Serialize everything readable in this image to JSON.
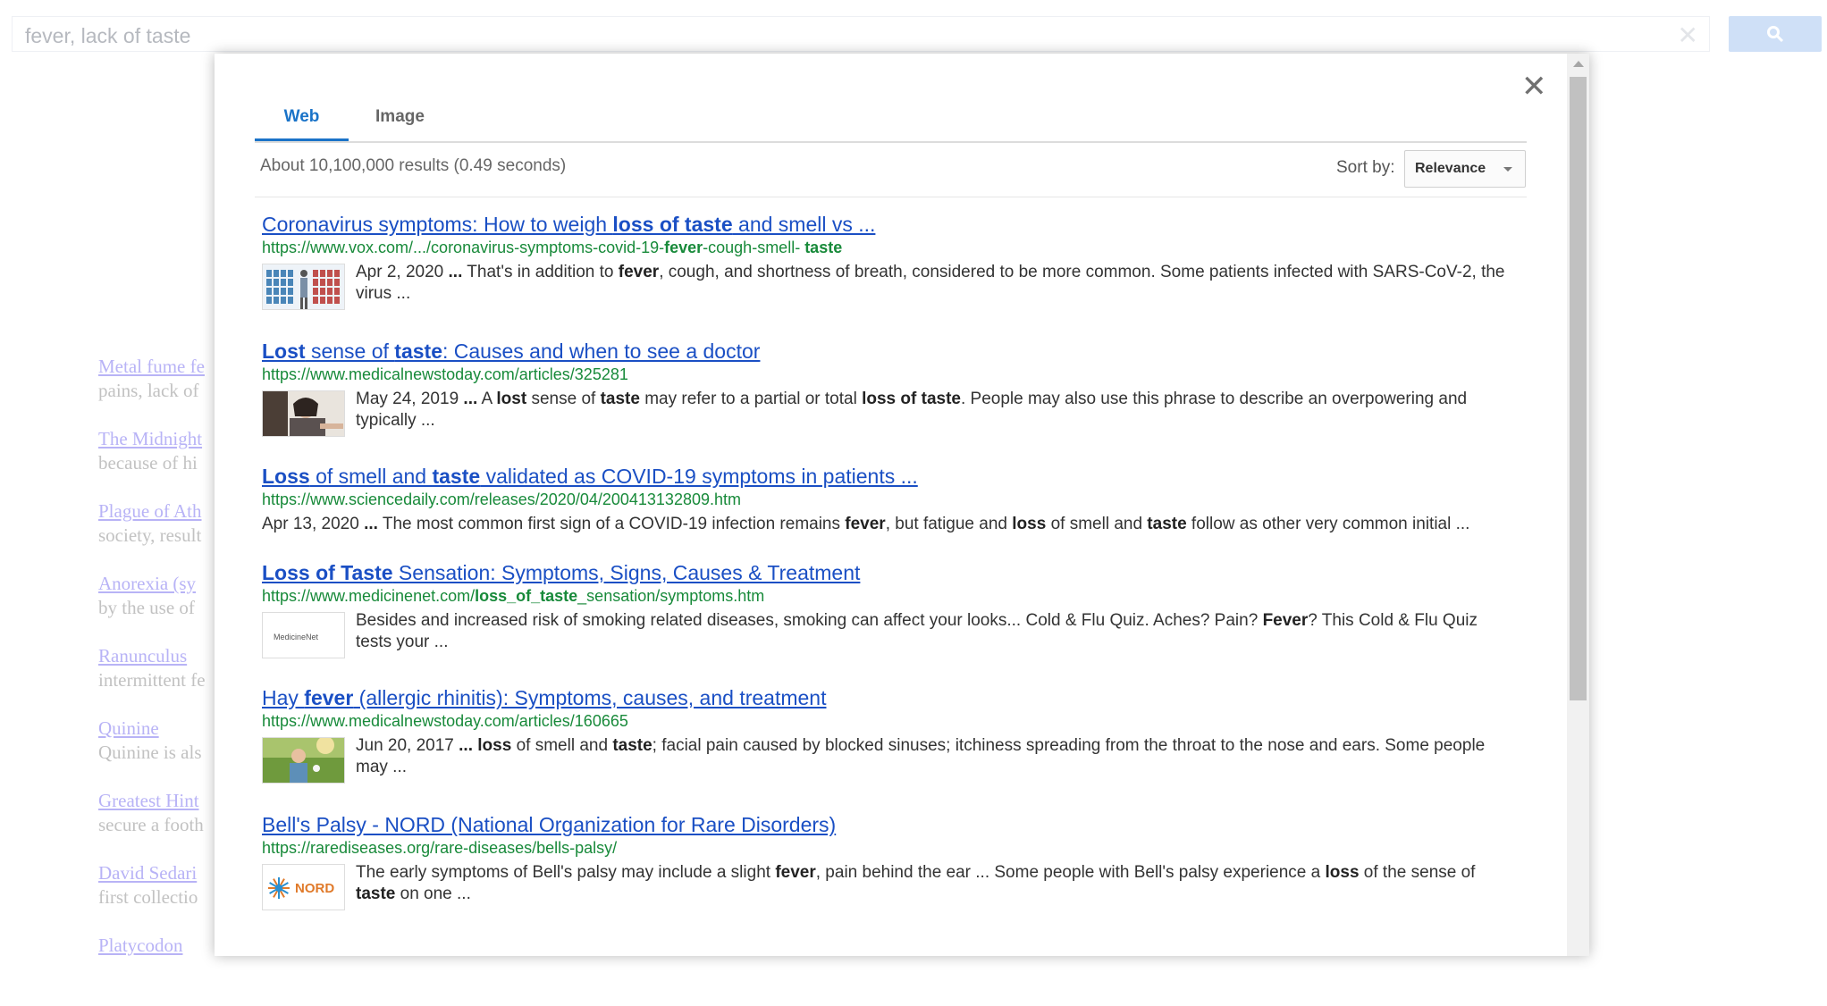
{
  "background": {
    "search_query": "fever, lack of taste",
    "clear_glyph": "✕",
    "items": [
      {
        "title": "Metal fume fe",
        "snippet": "pains, lack of"
      },
      {
        "title": "The Midnight",
        "snippet": "because of hi"
      },
      {
        "title": "Plague of Ath",
        "snippet": "society, result"
      },
      {
        "title": "Anorexia (sy",
        "snippet": "by the use of"
      },
      {
        "title": "Ranunculus",
        "snippet": "intermittent fe"
      },
      {
        "title": "Quinine",
        "snippet": "Quinine is als"
      },
      {
        "title": "Greatest Hint",
        "snippet": "secure a footh"
      },
      {
        "title": "David Sedari",
        "snippet": "first collectio"
      },
      {
        "title": "Platycodon",
        "snippet": ""
      }
    ]
  },
  "modal": {
    "close_glyph": "✕",
    "tabs": {
      "web": "Web",
      "image": "Image"
    },
    "result_count": "About 10,100,000 results (0.49 seconds)",
    "sort_label": "Sort by:",
    "sort_value": "Relevance"
  },
  "results": [
    {
      "title": [
        {
          "t": "Coronavirus symptoms: How to weigh "
        },
        {
          "t": "loss of taste",
          "b": true
        },
        {
          "t": " and smell vs ..."
        }
      ],
      "url": [
        {
          "t": "https://www.vox.com/.../coronavirus-symptoms-covid-19-"
        },
        {
          "t": "fever",
          "b": true
        },
        {
          "t": "-cough-smell- "
        },
        {
          "t": "taste",
          "b": true
        }
      ],
      "snippet": [
        {
          "t": "Apr 2, 2020 "
        },
        {
          "t": "...",
          "b": true
        },
        {
          "t": " That's in addition to "
        },
        {
          "t": "fever",
          "b": true
        },
        {
          "t": ", cough, and shortness of breath, considered to be more common. Some patients infected with SARS-CoV-2, the virus ..."
        }
      ],
      "thumb": "vox-figures-thumbnail"
    },
    {
      "title": [
        {
          "t": "Lost",
          "b": true
        },
        {
          "t": " sense of "
        },
        {
          "t": "taste",
          "b": true
        },
        {
          "t": ": Causes and when to see a doctor"
        }
      ],
      "url": [
        {
          "t": "https://www.medicalnewstoday.com/articles/325281"
        }
      ],
      "snippet": [
        {
          "t": "May 24, 2019 "
        },
        {
          "t": "...",
          "b": true
        },
        {
          "t": " A "
        },
        {
          "t": "lost",
          "b": true
        },
        {
          "t": " sense of "
        },
        {
          "t": "taste",
          "b": true
        },
        {
          "t": " may refer to a partial or total "
        },
        {
          "t": "loss of taste",
          "b": true
        },
        {
          "t": ". People may also use this phrase to describe an overpowering and typically ..."
        }
      ],
      "thumb": "woman-photo-thumbnail"
    },
    {
      "title": [
        {
          "t": "Loss",
          "b": true
        },
        {
          "t": " of smell and "
        },
        {
          "t": "taste",
          "b": true
        },
        {
          "t": " validated as COVID-19 symptoms in patients ..."
        }
      ],
      "url": [
        {
          "t": "https://www.sciencedaily.com/releases/2020/04/200413132809.htm"
        }
      ],
      "snippet": [
        {
          "t": "Apr 13, 2020 "
        },
        {
          "t": "...",
          "b": true
        },
        {
          "t": " The most common first sign of a COVID-19 infection remains "
        },
        {
          "t": "fever",
          "b": true
        },
        {
          "t": ", but fatigue and "
        },
        {
          "t": "loss",
          "b": true
        },
        {
          "t": " of smell and "
        },
        {
          "t": "taste",
          "b": true
        },
        {
          "t": " follow as other very common initial ..."
        }
      ],
      "thumb": ""
    },
    {
      "title": [
        {
          "t": "Loss of Taste",
          "b": true
        },
        {
          "t": " Sensation: Symptoms, Signs, Causes & Treatment"
        }
      ],
      "url": [
        {
          "t": "https://www.medicinenet.com/"
        },
        {
          "t": "loss_of_taste",
          "b": true
        },
        {
          "t": "_sensation/symptoms.htm"
        }
      ],
      "snippet": [
        {
          "t": "Besides and increased risk of smoking related diseases, smoking can affect your looks... Cold & Flu Quiz. Aches? Pain? "
        },
        {
          "t": "Fever",
          "b": true
        },
        {
          "t": "? This Cold & Flu Quiz tests your ..."
        }
      ],
      "thumb": "medicinenet-logo-thumbnail",
      "thumb_text": "MedicineNet"
    },
    {
      "title": [
        {
          "t": "Hay "
        },
        {
          "t": "fever",
          "b": true
        },
        {
          "t": " (allergic rhinitis): Symptoms, causes, and treatment"
        }
      ],
      "url": [
        {
          "t": "https://www.medicalnewstoday.com/articles/160665"
        }
      ],
      "snippet": [
        {
          "t": "Jun 20, 2017 "
        },
        {
          "t": "...",
          "b": true
        },
        {
          "t": " "
        },
        {
          "t": "loss",
          "b": true
        },
        {
          "t": " of smell and "
        },
        {
          "t": "taste",
          "b": true
        },
        {
          "t": "; facial pain caused by blocked sinuses; itchiness spreading from the throat to the nose and ears. Some people may ..."
        }
      ],
      "thumb": "child-outdoors-thumbnail"
    },
    {
      "title": [
        {
          "t": "Bell's Palsy - NORD (National Organization for Rare Disorders)"
        }
      ],
      "url": [
        {
          "t": "https://rarediseases.org/rare-diseases/bells-palsy/"
        }
      ],
      "snippet": [
        {
          "t": "The early symptoms of Bell's palsy may include a slight "
        },
        {
          "t": "fever",
          "b": true
        },
        {
          "t": ", pain behind the ear ... Some people with Bell's palsy experience a "
        },
        {
          "t": "loss",
          "b": true
        },
        {
          "t": " of the sense of "
        },
        {
          "t": "taste",
          "b": true
        },
        {
          "t": " on one ..."
        }
      ],
      "thumb": "nord-logo-thumbnail",
      "thumb_text": "NORD"
    }
  ]
}
